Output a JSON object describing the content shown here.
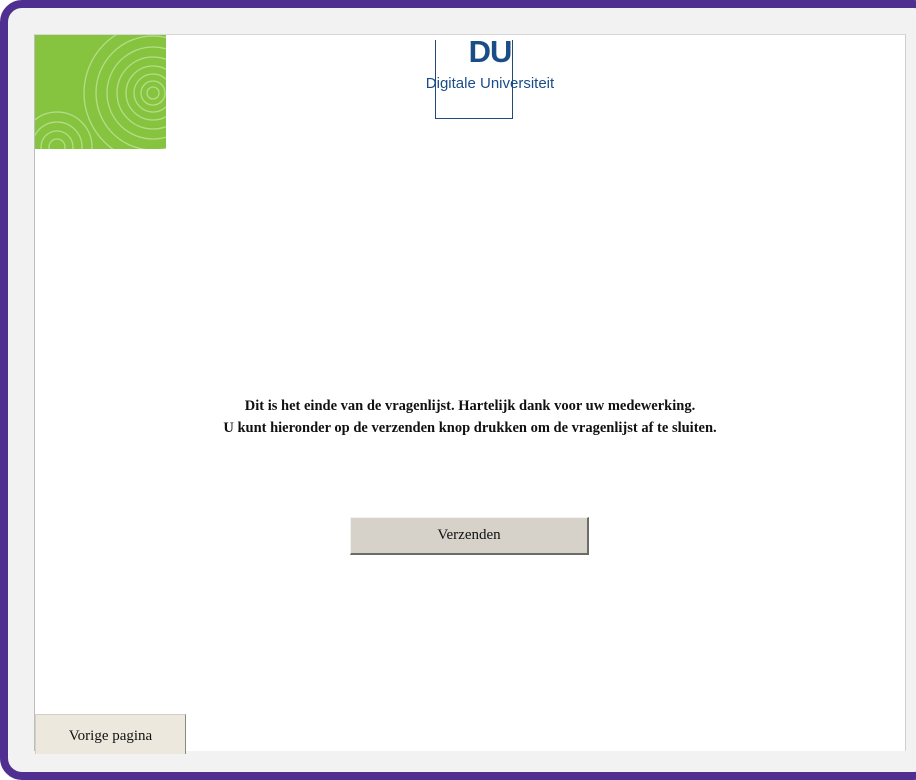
{
  "header": {
    "logo_abbrev": "DU",
    "logo_name": "Digitale Universiteit"
  },
  "main": {
    "message_line1": "Dit is het einde van de vragenlijst. Hartelijk dank voor uw medewerking.",
    "message_line2": "U kunt hieronder op de verzenden knop drukken om de vragenlijst af te sluiten.",
    "submit_label": "Verzenden"
  },
  "footer": {
    "prev_label": "Vorige pagina"
  },
  "colors": {
    "frame": "#4f2f8f",
    "green": "#86c440",
    "logo_blue": "#1a4d86",
    "button_face": "#d6d2ca"
  }
}
